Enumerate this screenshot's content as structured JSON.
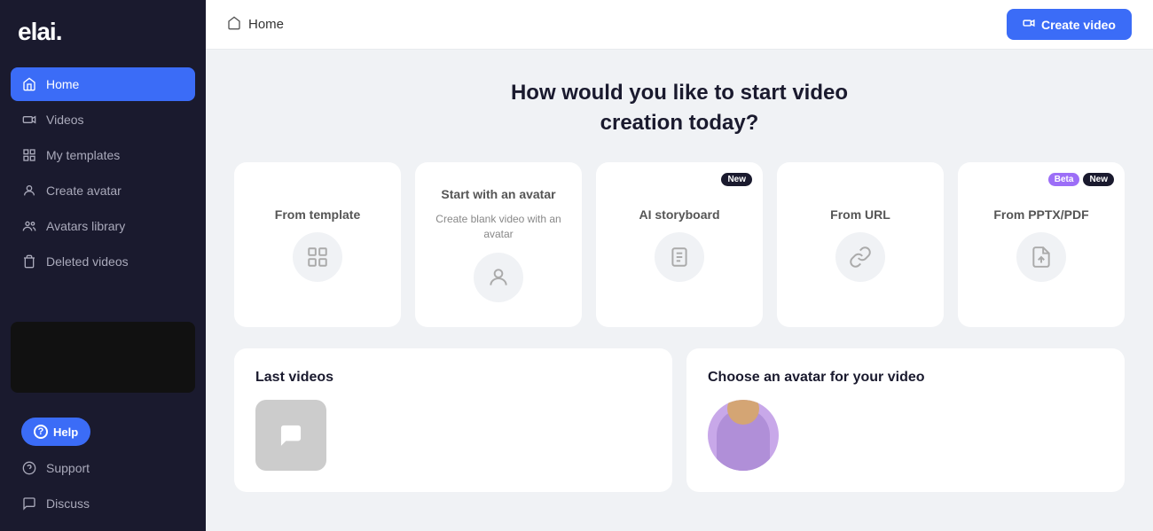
{
  "app": {
    "logo": "elai.",
    "title": "Home"
  },
  "sidebar": {
    "items": [
      {
        "id": "home",
        "label": "Home",
        "active": true
      },
      {
        "id": "videos",
        "label": "Videos",
        "active": false
      },
      {
        "id": "my-templates",
        "label": "My templates",
        "active": false
      },
      {
        "id": "create-avatar",
        "label": "Create avatar",
        "active": false
      },
      {
        "id": "avatars-library",
        "label": "Avatars library",
        "active": false
      },
      {
        "id": "deleted-videos",
        "label": "Deleted videos",
        "active": false
      }
    ],
    "bottom_items": [
      {
        "id": "support",
        "label": "Support"
      },
      {
        "id": "discuss",
        "label": "Discuss"
      }
    ],
    "help_label": "Help"
  },
  "topbar": {
    "breadcrumb": "Home",
    "create_button": "Create video"
  },
  "main": {
    "heading_line1": "How would you like to start video",
    "heading_line2": "creation today?",
    "cards": [
      {
        "id": "from-template",
        "title": "From template",
        "subtitle": "",
        "badge": null
      },
      {
        "id": "start-with-avatar",
        "title": "Start with an avatar",
        "subtitle": "Create blank video with an avatar",
        "badge": null
      },
      {
        "id": "ai-storyboard",
        "title": "AI storyboard",
        "subtitle": "",
        "badge": "new"
      },
      {
        "id": "from-url",
        "title": "From URL",
        "subtitle": "",
        "badge": null
      },
      {
        "id": "from-pptx",
        "title": "From PPTX/PDF",
        "subtitle": "",
        "badge_beta": "Beta",
        "badge_new": "New"
      }
    ],
    "last_videos_title": "Last videos",
    "choose_avatar_title": "Choose an avatar for your video"
  }
}
